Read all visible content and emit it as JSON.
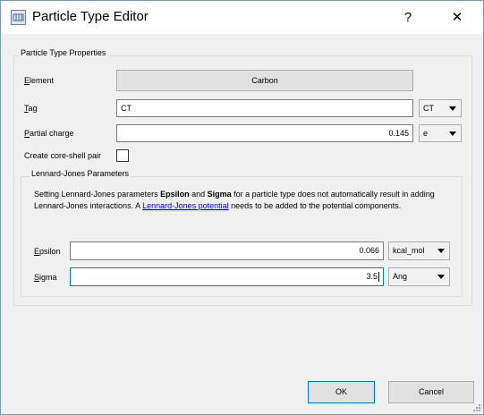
{
  "window": {
    "title": "Particle Type Editor",
    "help": "?",
    "close": "✕"
  },
  "properties": {
    "group_title": "Particle Type Properties",
    "element": {
      "label_key": "E",
      "label_rest": "lement",
      "value": "Carbon"
    },
    "tag": {
      "label_key": "T",
      "label_rest": "ag",
      "value": "CT",
      "combo": "CT"
    },
    "charge": {
      "label_key": "P",
      "label_rest": "artial charge",
      "value": "0.145",
      "unit": "e"
    },
    "core_shell": {
      "label": "Create core-shell pair",
      "checked": false
    }
  },
  "lj": {
    "group_title": "Lennard-Jones Parameters",
    "text1": "Setting Lennard-Jones parameters ",
    "b1": "Epsilon",
    "text2": " and ",
    "b2": "Sigma",
    "text3": " for a particle type does not automatically result in adding Lennard-Jones interactions. A ",
    "link": "Lennard-Jones potential",
    "text4": " needs to be added to the potential components.",
    "epsilon": {
      "label_key": "E",
      "label_rest": "psilon",
      "value": "0.066",
      "unit": "kcal_mol"
    },
    "sigma": {
      "label_key": "S",
      "label_rest": "igma",
      "value": "3.5",
      "unit": "Ang"
    }
  },
  "buttons": {
    "ok": "OK",
    "cancel": "Cancel"
  },
  "icons": {
    "app": "particle-editor-icon",
    "grip": "resize-grip-icon"
  }
}
